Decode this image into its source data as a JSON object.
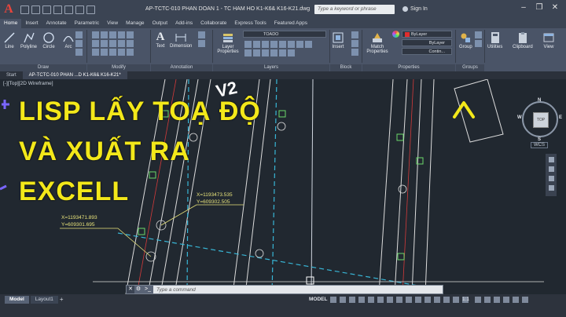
{
  "titlebar": {
    "app_logo": "A",
    "document_title": "AP-TCTC-010 PHAN DOAN 1 - TC HAM HO K1-K6& K16-K21.dwg",
    "search_placeholder": "Type a keyword or phrase",
    "sign_in": "Sign In",
    "minimize": "–",
    "restore": "❐",
    "close": "✕"
  },
  "ribbon_tabs": [
    "Home",
    "Insert",
    "Annotate",
    "Parametric",
    "View",
    "Manage",
    "Output",
    "Add-ins",
    "Collaborate",
    "Express Tools",
    "Featured Apps"
  ],
  "ribbon": {
    "draw_tools": [
      "Line",
      "Polyline",
      "Circle",
      "Arc"
    ],
    "draw_panel": "Draw",
    "modify_panel": "Modify",
    "annotation_tools": [
      "Text",
      "Dimension"
    ],
    "annotation_panel": "Annotation",
    "layer_properties": "Layer Properties",
    "layer_combo": "TOADO",
    "layers_panel": "Layers",
    "insert_tool": "Insert",
    "block_panel": "Block",
    "match_properties": "Match Properties",
    "bylayer_1": "ByLayer",
    "bylayer_2": "ByLayer",
    "continuous": "Contin...",
    "properties_panel": "Properties",
    "group_tool": "Group",
    "groups_panel": "Groups",
    "utilities": "Utilities",
    "clipboard": "Clipboard",
    "view": "View"
  },
  "file_tabs": [
    "Start",
    "AP-TCTC-010 PHAN ...D K1-K6& K16-K21*"
  ],
  "viewport": {
    "view_label": "[-][Top][2D Wireframe]",
    "overlay_lines": [
      "LISP LẤY TOẠ ĐỘ",
      "VÀ XUẤT RA",
      "EXCELL"
    ],
    "coord_1": [
      "X=1193473.535",
      "Y=609302.505"
    ],
    "coord_2": [
      "X=1193471.893",
      "Y=609301.695"
    ],
    "viewcube": {
      "top": "TOP",
      "n": "N",
      "s": "S",
      "e": "E",
      "w": "W"
    },
    "wcs": "WCS"
  },
  "command": {
    "placeholder": "Type a command",
    "prompt": ">_"
  },
  "status": {
    "layout_tabs": [
      "Model",
      "Layout1"
    ],
    "add_tab": "+",
    "model": "MODEL",
    "scale": "1:1"
  },
  "colors": {
    "overlay_text": "#f3e81a",
    "coord_text": "#e8e37a",
    "viewport_bg": "#212830",
    "ribbon_bg": "#4a5467"
  }
}
